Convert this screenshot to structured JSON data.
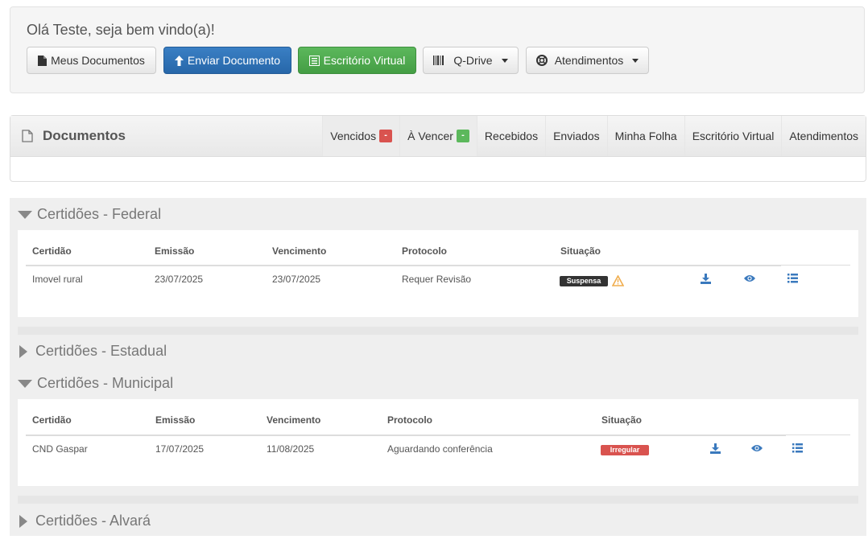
{
  "header": {
    "greeting": "Olá Teste, seja bem vindo(a)!",
    "buttons": {
      "meus_documentos": "Meus Documentos",
      "enviar_documento": "Enviar Documento",
      "escritorio_virtual": "Escritório Virtual",
      "qdrive": "Q-Drive",
      "atendimentos": "Atendimentos"
    }
  },
  "panel": {
    "title": "Documentos",
    "tabs": {
      "vencidos": "Vencidos",
      "vencidos_badge": "-",
      "a_vencer": "À Vencer",
      "a_vencer_badge": "-",
      "recebidos": "Recebidos",
      "enviados": "Enviados",
      "minha_folha": "Minha Folha",
      "escritorio_virtual": "Escritório Virtual",
      "atendimentos": "Atendimentos"
    }
  },
  "columns": {
    "certidao": "Certidão",
    "emissao": "Emissão",
    "vencimento": "Vencimento",
    "protocolo": "Protocolo",
    "situacao": "Situação"
  },
  "sections": {
    "federal": {
      "title": "Certidões - Federal",
      "row": {
        "certidao": "Imovel rural",
        "emissao": "23/07/2025",
        "vencimento": "23/07/2025",
        "protocolo": "Requer Revisão",
        "situacao": "Suspensa"
      }
    },
    "estadual": {
      "title": "Certidões - Estadual"
    },
    "municipal": {
      "title": "Certidões - Municipal",
      "row": {
        "certidao": "CND Gaspar",
        "emissao": "17/07/2025",
        "vencimento": "11/08/2025",
        "protocolo": "Aguardando conferência",
        "situacao": "Irregular"
      }
    },
    "alvara": {
      "title": "Certidões - Alvará"
    }
  },
  "colors": {
    "primary": "#2f72b7",
    "success": "#4cae4c",
    "danger": "#d9534f",
    "suspensa": "#333333",
    "warning": "#f0ad4e",
    "icon_blue": "#3a79bd"
  }
}
